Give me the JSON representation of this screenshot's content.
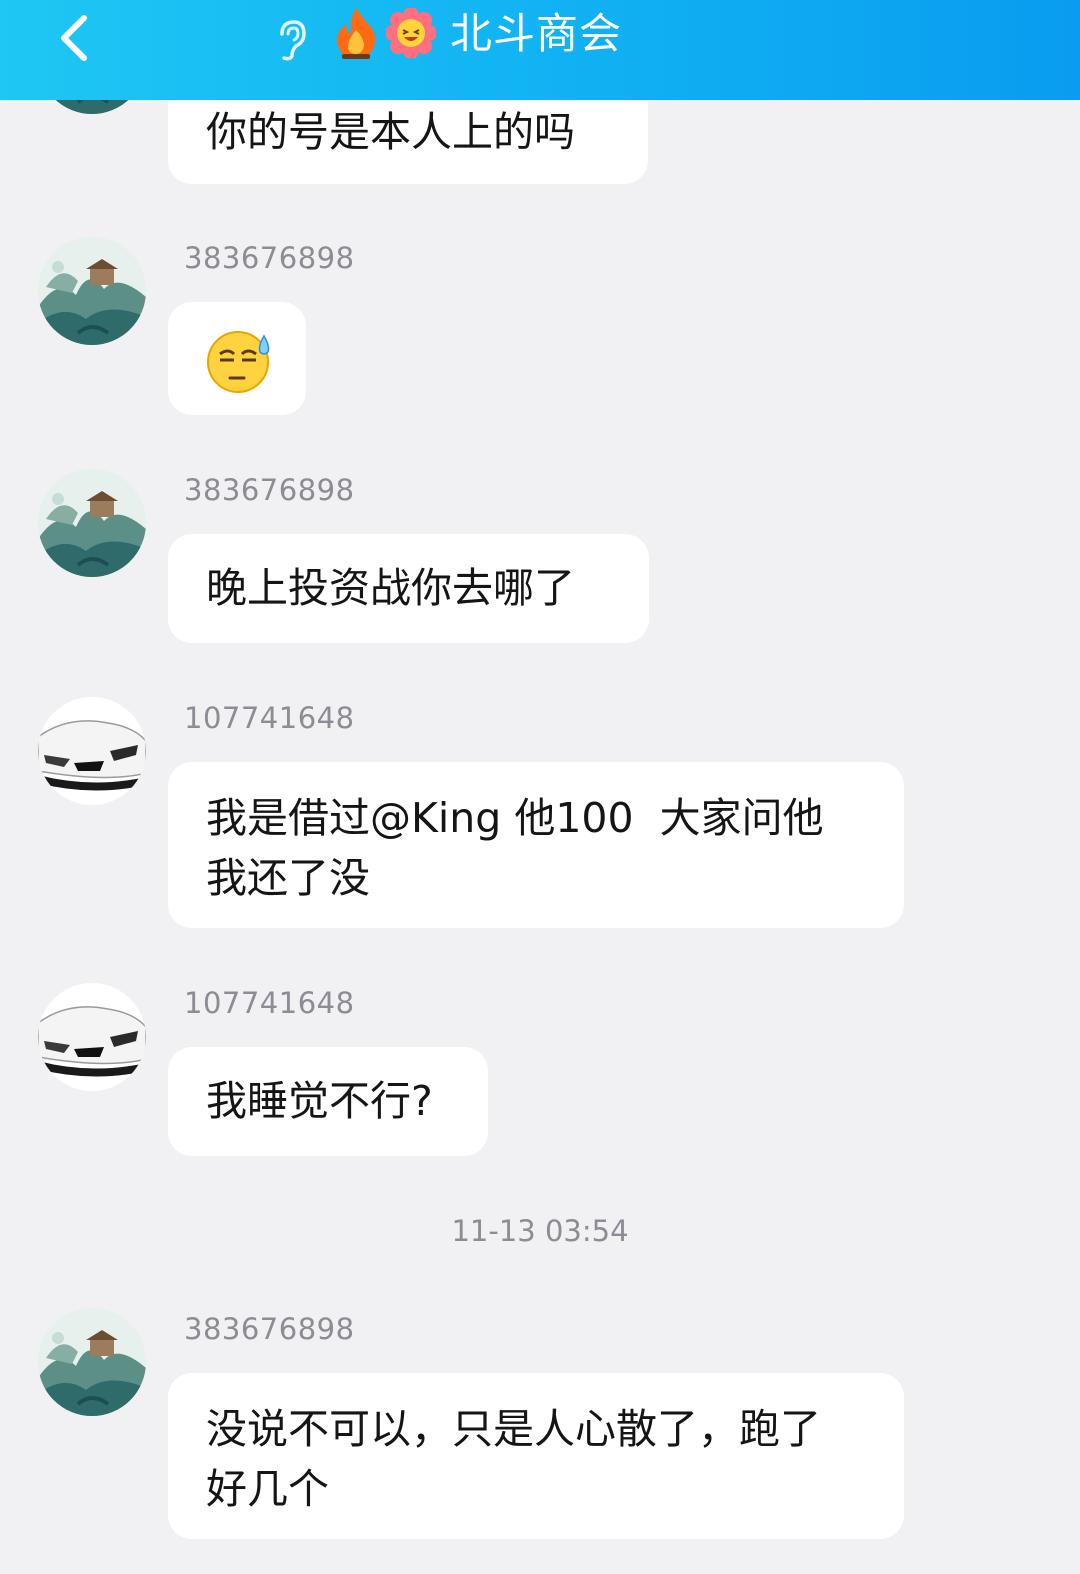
{
  "header": {
    "title": "北斗商会",
    "icons": [
      "back-icon",
      "ear-icon",
      "fire-icon",
      "flower-emoji-icon"
    ],
    "gradient": [
      "#1fc7f3",
      "#0a9cf0"
    ]
  },
  "messages": [
    {
      "avatar": "landscape-avatar",
      "text": "你的号是本人上的吗"
    },
    {
      "sender": "383676898",
      "avatar": "landscape-avatar",
      "emoji": "sweat-face-emoji"
    },
    {
      "sender": "383676898",
      "avatar": "landscape-avatar",
      "text": "晚上投资战你去哪了"
    },
    {
      "sender": "107741648",
      "avatar": "car-avatar",
      "text_lines": [
        "我是借过@King 他100  大家问他",
        "我还了没"
      ]
    },
    {
      "sender": "107741648",
      "avatar": "car-avatar",
      "text": "我睡觉不行?"
    },
    {
      "sender": "383676898",
      "avatar": "landscape-avatar",
      "text_lines": [
        "没说不可以，只是人心散了，跑了",
        "好几个"
      ]
    }
  ],
  "timestamp": "11-13 03:54"
}
